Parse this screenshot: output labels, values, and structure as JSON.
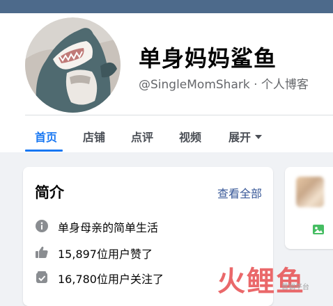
{
  "profile": {
    "name": "单身妈妈鲨鱼",
    "handle": "@SingleMomShark · 个人博客"
  },
  "tabs": [
    {
      "label": "首页"
    },
    {
      "label": "店铺"
    },
    {
      "label": "点评"
    },
    {
      "label": "视频"
    },
    {
      "label": "展开"
    }
  ],
  "intro": {
    "title": "简介",
    "see_all": "查看全部",
    "rows": [
      {
        "icon": "info-icon",
        "text": "单身母亲的简单生活"
      },
      {
        "icon": "thumbs-up-icon",
        "text": "15,897位用户赞了"
      },
      {
        "icon": "follow-check-icon",
        "text": "16,780位用户关注了"
      }
    ]
  },
  "side_card": {
    "icon": "photo-icon"
  },
  "watermark": {
    "main": "火鲤鱼",
    "sub": "营销平台"
  },
  "colors": {
    "accent": "#1877f2",
    "link": "#385898",
    "page_bg": "#f0f2f5",
    "top_band": "#4d6a8b",
    "photo_icon": "#45bd62",
    "watermark": "#e8585a"
  }
}
